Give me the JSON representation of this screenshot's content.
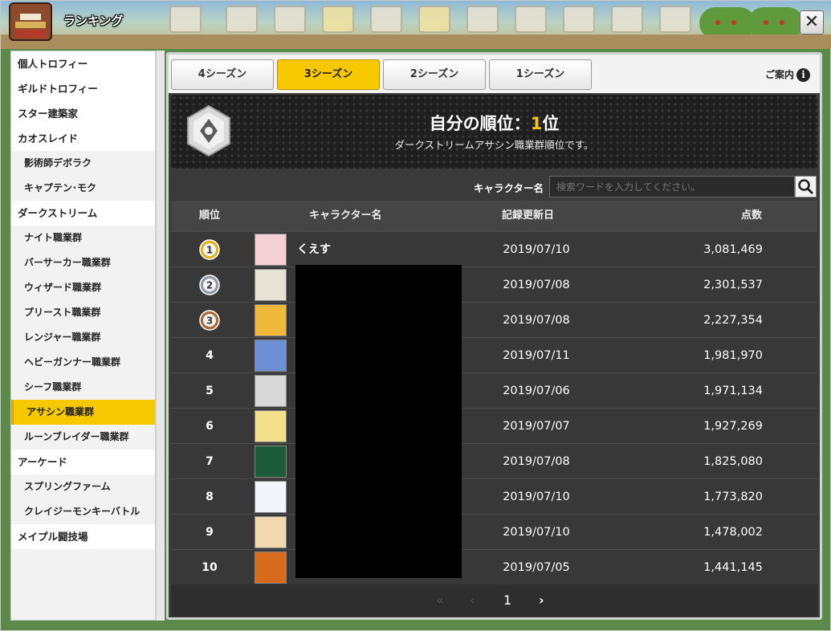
{
  "window": {
    "title": "ランキング",
    "close_label": "✕"
  },
  "sidebar": {
    "items": [
      {
        "label": "個人トロフィー",
        "level": "top"
      },
      {
        "label": "ギルドトロフィー",
        "level": "top"
      },
      {
        "label": "スター建築家",
        "level": "top"
      },
      {
        "label": "カオスレイド",
        "level": "top"
      },
      {
        "label": "影術師デボラク",
        "level": "sub"
      },
      {
        "label": "キャプテン･モク",
        "level": "sub"
      },
      {
        "label": "ダークストリーム",
        "level": "top"
      },
      {
        "label": "ナイト職業群",
        "level": "sub"
      },
      {
        "label": "バーサーカー職業群",
        "level": "sub"
      },
      {
        "label": "ウィザード職業群",
        "level": "sub"
      },
      {
        "label": "プリースト職業群",
        "level": "sub"
      },
      {
        "label": "レンジャー職業群",
        "level": "sub"
      },
      {
        "label": "ヘビーガンナー職業群",
        "level": "sub"
      },
      {
        "label": "シーフ職業群",
        "level": "sub"
      },
      {
        "label": "アサシン職業群",
        "level": "sub",
        "active": true
      },
      {
        "label": "ルーンブレイダー職業群",
        "level": "sub"
      },
      {
        "label": "アーケード",
        "level": "top"
      },
      {
        "label": "スプリングファーム",
        "level": "sub"
      },
      {
        "label": "クレイジーモンキーバトル",
        "level": "sub"
      },
      {
        "label": "メイプル闘技場",
        "level": "top"
      }
    ]
  },
  "tabs": [
    {
      "label": "4シーズン",
      "active": false
    },
    {
      "label": "3シーズン",
      "active": true
    },
    {
      "label": "2シーズン",
      "active": false
    },
    {
      "label": "1シーズン",
      "active": false
    }
  ],
  "guide_label": "ご案内",
  "banner": {
    "title_prefix": "自分の順位：",
    "rank_value": "1",
    "rank_suffix": "位",
    "subtitle": "ダークストリームアサシン職業群順位です。"
  },
  "search": {
    "label": "キャラクター名",
    "placeholder": "検索ワードを入力してください。"
  },
  "table": {
    "headers": {
      "rank": "順位",
      "name": "キャラクター名",
      "date": "記録更新日",
      "score": "点数"
    },
    "rows": [
      {
        "rank": "1",
        "medal": "gold",
        "name": "くえす",
        "date": "2019/07/10",
        "score": "3,081,469",
        "avatar": "#f5cfd6"
      },
      {
        "rank": "2",
        "medal": "silver",
        "name": "",
        "date": "2019/07/08",
        "score": "2,301,537",
        "avatar": "#e9e3d6"
      },
      {
        "rank": "3",
        "medal": "bronze",
        "name": "",
        "date": "2019/07/08",
        "score": "2,227,354",
        "avatar": "#f0b93a"
      },
      {
        "rank": "4",
        "medal": "",
        "name": "",
        "date": "2019/07/11",
        "score": "1,981,970",
        "avatar": "#6d8fd6"
      },
      {
        "rank": "5",
        "medal": "",
        "name": "",
        "date": "2019/07/06",
        "score": "1,971,134",
        "avatar": "#d8d8d8"
      },
      {
        "rank": "6",
        "medal": "",
        "name": "",
        "date": "2019/07/07",
        "score": "1,927,269",
        "avatar": "#f2e08a"
      },
      {
        "rank": "7",
        "medal": "",
        "name": "",
        "date": "2019/07/08",
        "score": "1,825,080",
        "avatar": "#1b5a3a"
      },
      {
        "rank": "8",
        "medal": "",
        "name": "",
        "date": "2019/07/10",
        "score": "1,773,820",
        "avatar": "#f2f6fa"
      },
      {
        "rank": "9",
        "medal": "",
        "name": "",
        "date": "2019/07/10",
        "score": "1,478,002",
        "avatar": "#f3d9b0"
      },
      {
        "rank": "10",
        "medal": "",
        "name": "",
        "date": "2019/07/05",
        "score": "1,441,145",
        "avatar": "#d86a1c"
      }
    ]
  },
  "pager": {
    "first": "«",
    "prev": "‹",
    "current": "1",
    "next": "›"
  },
  "colors": {
    "accent": "#f7c800",
    "panel": "#383838",
    "gold": "#e0b321",
    "silver": "#8a9aa8",
    "bronze": "#b06a35"
  }
}
